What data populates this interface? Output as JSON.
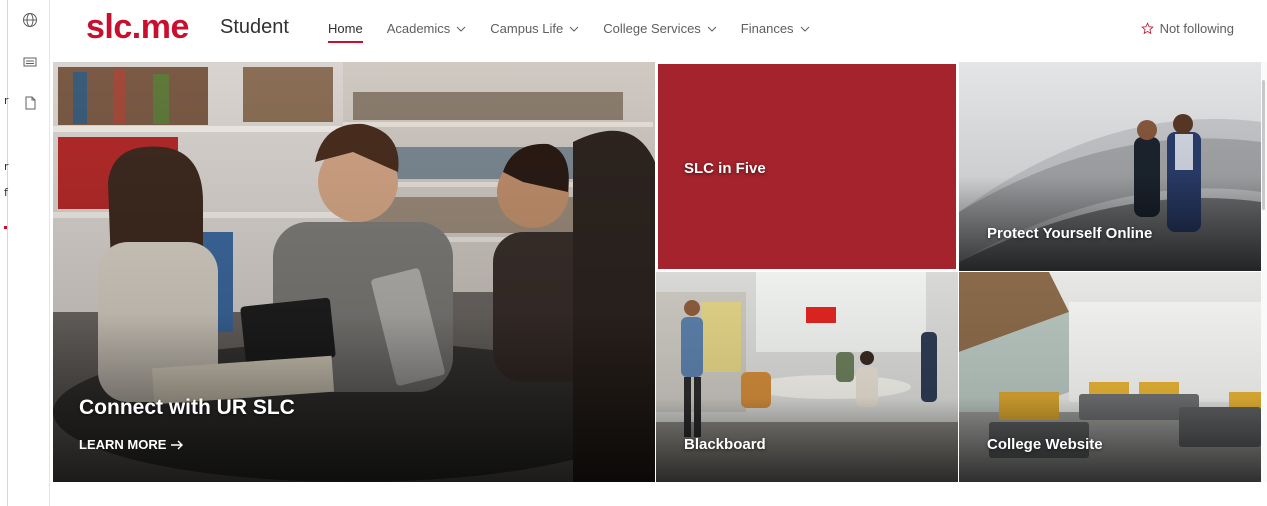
{
  "rail": {
    "icons": [
      "globe-icon",
      "news-icon",
      "page-icon"
    ]
  },
  "header": {
    "logo": "slc.me",
    "site_title": "Student",
    "nav": [
      {
        "label": "Home",
        "active": true,
        "dropdown": false
      },
      {
        "label": "Academics",
        "active": false,
        "dropdown": true
      },
      {
        "label": "Campus Life",
        "active": false,
        "dropdown": true
      },
      {
        "label": "College Services",
        "active": false,
        "dropdown": true
      },
      {
        "label": "Finances",
        "active": false,
        "dropdown": true
      }
    ],
    "follow_label": "Not following",
    "follow_icon": "star-outline-icon"
  },
  "hero": {
    "main": {
      "title": "Connect with UR SLC",
      "cta": "LEARN MORE",
      "cta_icon": "arrow-right-icon"
    },
    "tiles": [
      {
        "title": "SLC in Five"
      },
      {
        "title": "Protect Yourself Online"
      },
      {
        "title": "Blackboard"
      },
      {
        "title": "College Website"
      }
    ]
  },
  "colors": {
    "brand": "#c8102e",
    "tile_red": "#a4232c",
    "nav_text": "#605e5c"
  }
}
